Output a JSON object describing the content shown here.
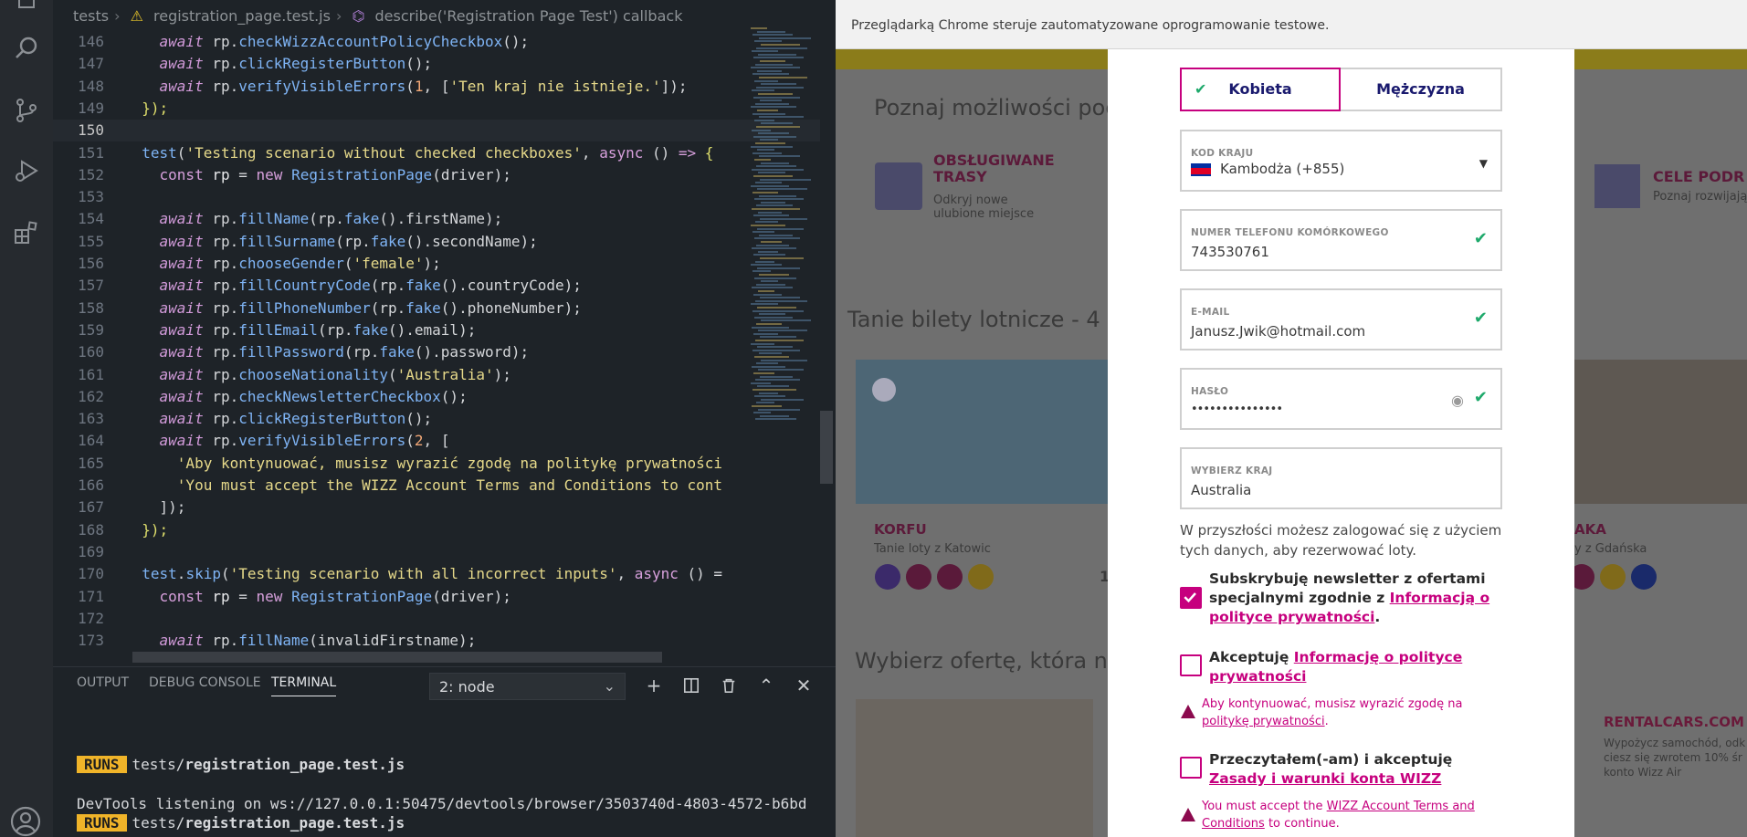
{
  "breadcrumb": {
    "items": [
      "tests",
      "registration_page.test.js",
      "describe('Registration Page Test') callback"
    ]
  },
  "editor": {
    "lines": [
      {
        "n": "146",
        "code": [
          [
            "    ",
            ""
          ],
          [
            "await",
            "kw"
          ],
          [
            " rp.",
            "pl"
          ],
          [
            "checkWizzAccountPolicyCheckbox",
            "fn"
          ],
          [
            "();",
            "pun"
          ]
        ]
      },
      {
        "n": "147",
        "code": [
          [
            "    ",
            ""
          ],
          [
            "await",
            "kw"
          ],
          [
            " rp.",
            "pl"
          ],
          [
            "clickRegisterButton",
            "fn"
          ],
          [
            "();",
            "pun"
          ]
        ]
      },
      {
        "n": "148",
        "code": [
          [
            "    ",
            ""
          ],
          [
            "await",
            "kw"
          ],
          [
            " rp.",
            "pl"
          ],
          [
            "verifyVisibleErrors",
            "fn"
          ],
          [
            "(",
            "pun"
          ],
          [
            "1",
            "num"
          ],
          [
            ", [",
            "pun"
          ],
          [
            "'Ten kraj nie istnieje.'",
            "str"
          ],
          [
            "]);",
            "pun"
          ]
        ]
      },
      {
        "n": "149",
        "code": [
          [
            "  ",
            ""
          ],
          [
            "});",
            "cb"
          ]
        ]
      },
      {
        "n": "150",
        "code": [],
        "current": true
      },
      {
        "n": "151",
        "code": [
          [
            "  ",
            ""
          ],
          [
            "test",
            "fn"
          ],
          [
            "(",
            "pun"
          ],
          [
            "'Testing scenario without checked checkboxes'",
            "str"
          ],
          [
            ", ",
            "pun"
          ],
          [
            "async",
            "kw2"
          ],
          [
            " () ",
            "pun"
          ],
          [
            "=>",
            "kw2"
          ],
          [
            " {",
            "cb"
          ]
        ]
      },
      {
        "n": "152",
        "code": [
          [
            "    ",
            ""
          ],
          [
            "const",
            "kw2"
          ],
          [
            " ",
            "pl"
          ],
          [
            "rp",
            "vr"
          ],
          [
            " = ",
            "pl"
          ],
          [
            "new",
            "kw2"
          ],
          [
            " ",
            "pl"
          ],
          [
            "RegistrationPage",
            "fn"
          ],
          [
            "(driver);",
            "pun"
          ]
        ]
      },
      {
        "n": "153",
        "code": []
      },
      {
        "n": "154",
        "code": [
          [
            "    ",
            ""
          ],
          [
            "await",
            "kw"
          ],
          [
            " rp.",
            "pl"
          ],
          [
            "fillName",
            "fn"
          ],
          [
            "(rp.",
            "pun"
          ],
          [
            "fake",
            "fn"
          ],
          [
            "().firstName);",
            "pun"
          ]
        ]
      },
      {
        "n": "155",
        "code": [
          [
            "    ",
            ""
          ],
          [
            "await",
            "kw"
          ],
          [
            " rp.",
            "pl"
          ],
          [
            "fillSurname",
            "fn"
          ],
          [
            "(rp.",
            "pun"
          ],
          [
            "fake",
            "fn"
          ],
          [
            "().secondName);",
            "pun"
          ]
        ]
      },
      {
        "n": "156",
        "code": [
          [
            "    ",
            ""
          ],
          [
            "await",
            "kw"
          ],
          [
            " rp.",
            "pl"
          ],
          [
            "chooseGender",
            "fn"
          ],
          [
            "(",
            "pun"
          ],
          [
            "'female'",
            "str"
          ],
          [
            ");",
            "pun"
          ]
        ]
      },
      {
        "n": "157",
        "code": [
          [
            "    ",
            ""
          ],
          [
            "await",
            "kw"
          ],
          [
            " rp.",
            "pl"
          ],
          [
            "fillCountryCode",
            "fn"
          ],
          [
            "(rp.",
            "pun"
          ],
          [
            "fake",
            "fn"
          ],
          [
            "().countryCode);",
            "pun"
          ]
        ]
      },
      {
        "n": "158",
        "code": [
          [
            "    ",
            ""
          ],
          [
            "await",
            "kw"
          ],
          [
            " rp.",
            "pl"
          ],
          [
            "fillPhoneNumber",
            "fn"
          ],
          [
            "(rp.",
            "pun"
          ],
          [
            "fake",
            "fn"
          ],
          [
            "().phoneNumber);",
            "pun"
          ]
        ]
      },
      {
        "n": "159",
        "code": [
          [
            "    ",
            ""
          ],
          [
            "await",
            "kw"
          ],
          [
            " rp.",
            "pl"
          ],
          [
            "fillEmail",
            "fn"
          ],
          [
            "(rp.",
            "pun"
          ],
          [
            "fake",
            "fn"
          ],
          [
            "().email);",
            "pun"
          ]
        ]
      },
      {
        "n": "160",
        "code": [
          [
            "    ",
            ""
          ],
          [
            "await",
            "kw"
          ],
          [
            " rp.",
            "pl"
          ],
          [
            "fillPassword",
            "fn"
          ],
          [
            "(rp.",
            "pun"
          ],
          [
            "fake",
            "fn"
          ],
          [
            "().password);",
            "pun"
          ]
        ]
      },
      {
        "n": "161",
        "code": [
          [
            "    ",
            ""
          ],
          [
            "await",
            "kw"
          ],
          [
            " rp.",
            "pl"
          ],
          [
            "chooseNationality",
            "fn"
          ],
          [
            "(",
            "pun"
          ],
          [
            "'Australia'",
            "str"
          ],
          [
            ");",
            "pun"
          ]
        ]
      },
      {
        "n": "162",
        "code": [
          [
            "    ",
            ""
          ],
          [
            "await",
            "kw"
          ],
          [
            " rp.",
            "pl"
          ],
          [
            "checkNewsletterCheckbox",
            "fn"
          ],
          [
            "();",
            "pun"
          ]
        ]
      },
      {
        "n": "163",
        "code": [
          [
            "    ",
            ""
          ],
          [
            "await",
            "kw"
          ],
          [
            " rp.",
            "pl"
          ],
          [
            "clickRegisterButton",
            "fn"
          ],
          [
            "();",
            "pun"
          ]
        ]
      },
      {
        "n": "164",
        "code": [
          [
            "    ",
            ""
          ],
          [
            "await",
            "kw"
          ],
          [
            " rp.",
            "pl"
          ],
          [
            "verifyVisibleErrors",
            "fn"
          ],
          [
            "(",
            "pun"
          ],
          [
            "2",
            "num"
          ],
          [
            ", [",
            "pun"
          ]
        ]
      },
      {
        "n": "165",
        "code": [
          [
            "      ",
            ""
          ],
          [
            "'Aby kontynuować, musisz wyrazić zgodę na politykę prywatności",
            "str"
          ]
        ]
      },
      {
        "n": "166",
        "code": [
          [
            "      ",
            ""
          ],
          [
            "'You must accept the WIZZ Account Terms and Conditions to cont",
            "str"
          ]
        ]
      },
      {
        "n": "167",
        "code": [
          [
            "    ",
            ""
          ],
          [
            "]);",
            "pun"
          ]
        ]
      },
      {
        "n": "168",
        "code": [
          [
            "  ",
            ""
          ],
          [
            "});",
            "cb"
          ]
        ]
      },
      {
        "n": "169",
        "code": []
      },
      {
        "n": "170",
        "code": [
          [
            "  ",
            ""
          ],
          [
            "test",
            "fn"
          ],
          [
            ".",
            "pun"
          ],
          [
            "skip",
            "fn"
          ],
          [
            "(",
            "pun"
          ],
          [
            "'Testing scenario with all incorrect inputs'",
            "str"
          ],
          [
            ", ",
            "pun"
          ],
          [
            "async",
            "kw2"
          ],
          [
            " () =",
            "pun"
          ]
        ]
      },
      {
        "n": "171",
        "code": [
          [
            "    ",
            ""
          ],
          [
            "const",
            "kw2"
          ],
          [
            " ",
            "pl"
          ],
          [
            "rp",
            "vr"
          ],
          [
            " = ",
            "pl"
          ],
          [
            "new",
            "kw2"
          ],
          [
            " ",
            "pl"
          ],
          [
            "RegistrationPage",
            "fn"
          ],
          [
            "(driver);",
            "pun"
          ]
        ]
      },
      {
        "n": "172",
        "code": []
      },
      {
        "n": "173",
        "code": [
          [
            "    ",
            ""
          ],
          [
            "await",
            "kw"
          ],
          [
            " rp.",
            "pl"
          ],
          [
            "fillName",
            "fn"
          ],
          [
            "(invalidFirstname);",
            "pun"
          ]
        ]
      }
    ]
  },
  "panel": {
    "tabs": [
      "OUTPUT",
      "DEBUG CONSOLE",
      "TERMINAL"
    ],
    "active_tab": "TERMINAL",
    "terminal_select": "2: node",
    "lines": [
      {
        "badge": "RUNS",
        "prefix": "tests/",
        "file": "registration_page.test.js"
      },
      {
        "text": "DevTools listening on ws://127.0.0.1:50475/devtools/browser/3503740d-4803-4572-b6bd"
      },
      {
        "badge": "RUNS",
        "prefix": "tests/",
        "file": "registration_page.test.js"
      }
    ]
  },
  "browser": {
    "automation_notice": "Przeglądarką Chrome steruje zautomatyzowane oprogramowanie testowe.",
    "background": {
      "heading1": "Poznaj możliwości poc",
      "route_title": "OBSŁUGIWANE TRASY",
      "route_sub": "Odkryj nowe ulubione miejsce",
      "cele_title": "CELE PODR",
      "cele_sub": "Poznaj rozwijają",
      "heading2": "Tanie bilety lotnicze - 4",
      "card1_city": "KORFU",
      "card1_sub": "Tanie loty z Katowic",
      "card2_city": "AKA",
      "card2_sub": "y z Gdańska",
      "heading3": "Wybierz ofertę, która na",
      "rental_title": "RENTALCARS.COM",
      "rental_text": "Wypożycz samochód, odk ciesz się zwrotem 10% śr konto Wizz Air",
      "num_fragment": "1"
    },
    "form": {
      "gender_female": "Kobieta",
      "gender_male": "Mężczyzna",
      "country_code_label": "KOD KRAJU",
      "country_code_value": "Kambodża (+855)",
      "phone_label": "NUMER TELEFONU KOMÓRKOWEGO",
      "phone_value": "743530761",
      "email_label": "E-MAIL",
      "email_value": "Janusz.Jwik@hotmail.com",
      "password_label": "HASŁO",
      "password_value": "•••••••••••••••",
      "country_label": "WYBIERZ KRAJ",
      "country_value": "Australia",
      "info": "W przyszłości możesz zalogować się z użyciem tych danych, aby rezerwować loty.",
      "newsletter_text": "Subskrybuję newsletter z ofertami specjalnymi zgodnie z ",
      "newsletter_link": "Informacją o polityce prywatności",
      "newsletter_checked": true,
      "privacy_text": "Akceptuję ",
      "privacy_link": "Informację o polityce prywatności",
      "privacy_checked": false,
      "privacy_error_text": "Aby kontynuować, musisz wyrazić zgodę na ",
      "privacy_error_link": "politykę prywatności",
      "terms_text": "Przeczytałem(-am) i akceptuję ",
      "terms_link": "Zasady i warunki konta WIZZ",
      "terms_checked": false,
      "terms_error_text": "You must accept the ",
      "terms_error_link": "WIZZ Account Terms and Conditions",
      "terms_error_suffix": " to continue."
    }
  },
  "colors": {
    "accent": "#c6007e",
    "valid": "#1ea96b",
    "editor_bg": "#1e2328"
  }
}
